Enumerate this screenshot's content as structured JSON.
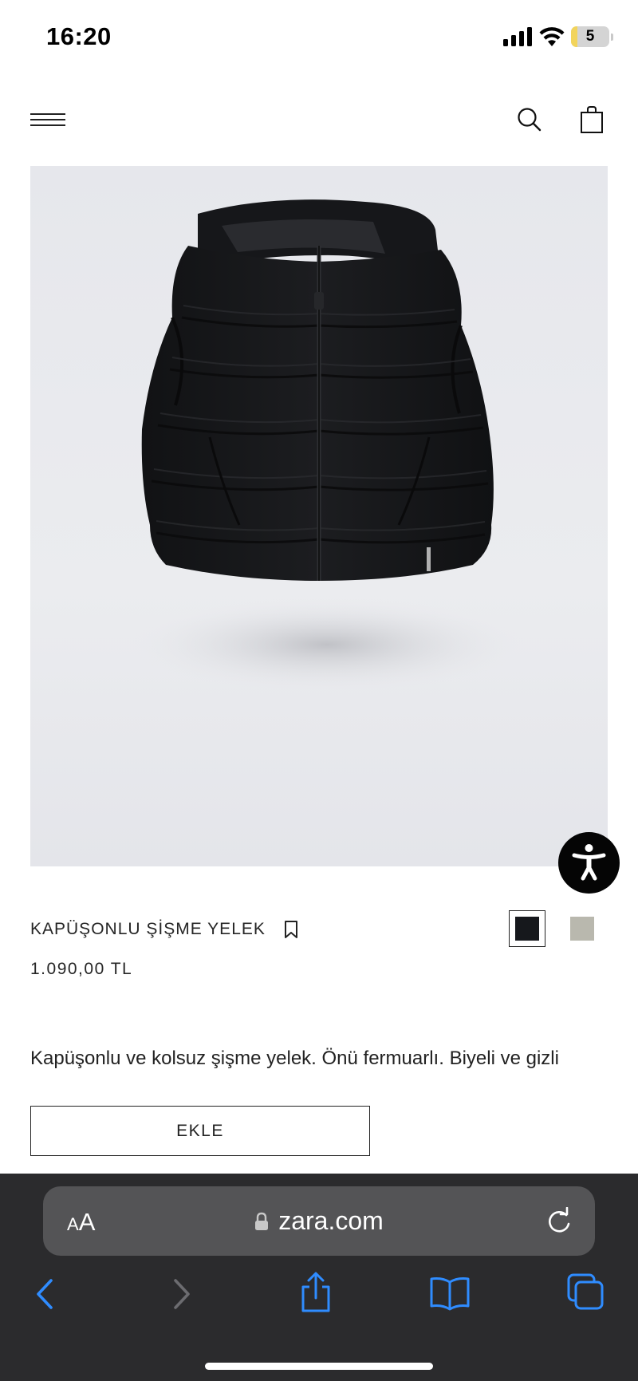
{
  "status_bar": {
    "time": "16:20",
    "battery_label": "5",
    "battery_level_percent": 5
  },
  "header": {
    "menu_icon": "hamburger-menu-icon",
    "search_icon": "search-icon",
    "bag_icon": "shopping-bag-icon"
  },
  "product": {
    "name": "KAPÜŞONLU ŞİŞME YELEK",
    "price": "1.090,00 TL",
    "description": "Kapüşonlu ve kolsuz şişme yelek. Önü fermuarlı. Biyeli ve gizli",
    "add_label": "EKLE",
    "colors": [
      {
        "hex": "#16181c",
        "selected": true
      },
      {
        "hex": "#b9b8ae",
        "selected": false
      }
    ],
    "image_background": "#e8e9ed"
  },
  "browser": {
    "aa_small": "A",
    "aa_big": "A",
    "url": "zara.com",
    "accent_color": "#2f8cff"
  }
}
